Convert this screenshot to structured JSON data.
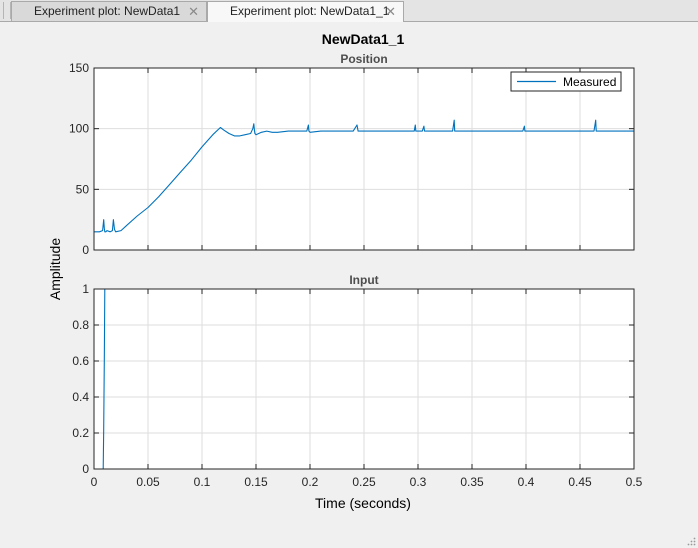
{
  "tabs": [
    {
      "label": "Experiment plot: NewData1",
      "active": false
    },
    {
      "label": "Experiment plot: NewData1_1",
      "active": true
    }
  ],
  "figure_title": "NewData1_1",
  "colors": {
    "series": "#0072bd",
    "grid": "#dedede",
    "axis": "#262626",
    "background": "#ffffff"
  },
  "chart_data": [
    {
      "type": "line",
      "title": "Position",
      "xlabel": "",
      "ylabel": "Amplitude",
      "xlim": [
        0,
        0.5
      ],
      "ylim": [
        0,
        150
      ],
      "yticks": [
        "0",
        "50",
        "100",
        "150"
      ],
      "grid": true,
      "legend": {
        "position": "top-right",
        "entries": [
          "Measured"
        ]
      },
      "series": [
        {
          "name": "Measured",
          "x": [
            0,
            0.005,
            0.008,
            0.009,
            0.0095,
            0.01,
            0.011,
            0.012,
            0.015,
            0.017,
            0.018,
            0.019,
            0.02,
            0.025,
            0.03,
            0.04,
            0.05,
            0.06,
            0.07,
            0.08,
            0.09,
            0.1,
            0.11,
            0.117,
            0.12,
            0.125,
            0.13,
            0.135,
            0.14,
            0.145,
            0.147,
            0.148,
            0.1485,
            0.149,
            0.15,
            0.155,
            0.16,
            0.165,
            0.17,
            0.18,
            0.19,
            0.197,
            0.1985,
            0.199,
            0.2,
            0.21,
            0.22,
            0.23,
            0.24,
            0.2435,
            0.2445,
            0.245,
            0.25,
            0.26,
            0.27,
            0.28,
            0.29,
            0.2965,
            0.2975,
            0.298,
            0.3,
            0.304,
            0.3055,
            0.306,
            0.31,
            0.32,
            0.332,
            0.3335,
            0.334,
            0.34,
            0.35,
            0.36,
            0.37,
            0.38,
            0.39,
            0.397,
            0.3985,
            0.399,
            0.41,
            0.42,
            0.43,
            0.44,
            0.45,
            0.463,
            0.4645,
            0.465,
            0.47,
            0.48,
            0.49,
            0.5
          ],
          "values": [
            15,
            15,
            16,
            25,
            18,
            15,
            15,
            16,
            15,
            16,
            25,
            17,
            15,
            16,
            20,
            28,
            35,
            44,
            54,
            64,
            74,
            85,
            95,
            101,
            99,
            96,
            94,
            94,
            95,
            96,
            100,
            104,
            99,
            96,
            95,
            97,
            98,
            97,
            97,
            98,
            98,
            98,
            103,
            98,
            97,
            98,
            98,
            98,
            98,
            103,
            98,
            98,
            98,
            98,
            98,
            98,
            98,
            98,
            103,
            98,
            98,
            98,
            102,
            98,
            98,
            98,
            98,
            107,
            98,
            98,
            98,
            98,
            98,
            98,
            98,
            98,
            102,
            98,
            98,
            98,
            98,
            98,
            98,
            98,
            107,
            98,
            98,
            98,
            98,
            98
          ]
        }
      ]
    },
    {
      "type": "line",
      "title": "Input",
      "xlabel": "Time (seconds)",
      "ylabel": "",
      "xlim": [
        0,
        0.5
      ],
      "ylim": [
        0,
        1
      ],
      "xticks": [
        "0",
        "0.05",
        "0.1",
        "0.15",
        "0.2",
        "0.25",
        "0.3",
        "0.35",
        "0.4",
        "0.45",
        "0.5"
      ],
      "yticks": [
        "0",
        "0.2",
        "0.4",
        "0.6",
        "0.8",
        "1"
      ],
      "grid": true,
      "series": [
        {
          "x": [
            0,
            0.0085,
            0.009,
            0.0095,
            0.01,
            0.5
          ],
          "values": [
            0,
            0,
            0.22,
            0.6,
            1,
            1
          ]
        }
      ]
    }
  ]
}
